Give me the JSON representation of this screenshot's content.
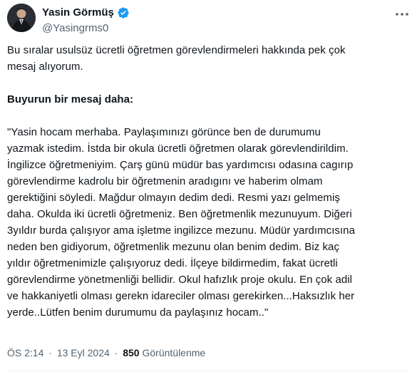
{
  "author": {
    "display_name": "Yasin Görmüş",
    "handle": "@Yasingrms0"
  },
  "icons": {
    "verified": "verified-badge-icon",
    "more": "more-options-icon",
    "verified_color": "#1d9bf0"
  },
  "body": {
    "intro_lines": [
      "Bu sıralar usulsüz ücretli öğretmen görevlendirmeleri hakkında pek çok",
      "mesaj alıyorum."
    ],
    "heading": "Buyurun bir mesaj daha:",
    "quote_lines": [
      "\"Yasin hocam merhaba. Paylaşımınızı görünce ben de durumumu",
      "yazmak istedim. İstda bir okula ücretli öğretmen olarak görevlendirildim.",
      "İngilizce öğretmeniyim. Çarş günü müdür bas yardımcısı odasına cagırıp",
      "görevlendirme kadrolu bir öğretmenin aradıgını ve haberim olmam",
      "gerektiğini söyledi. Mağdur olmayın dedim dedi. Resmi yazı gelmemiş",
      "daha. Okulda iki ücretli öğretmeniz. Ben öğretmenlik mezunuyum. Diğeri",
      "3yıldır burda çalışıyor ama işletme ingilizce mezunu. Müdür yardımcısına",
      "neden ben gidiyorum, öğretmenlik mezunu olan benim dedim. Biz kaç",
      "yıldır öğretmenimizle çalışıyoruz dedi. İlçeye bildirmedim, fakat ücretli",
      "görevlendirme yönetmenliği bellidir. Okul hafızlık proje okulu. En çok adil",
      "ve hakkaniyetli olması gerekn idareciler olması gerekirken...Haksızlık her",
      "yerde..Lütfen benim durumumu da paylaşınız hocam..\""
    ]
  },
  "meta": {
    "time": "ÖS 2:14",
    "separator": "·",
    "date": "13 Eyl 2024",
    "views_count": "850",
    "views_label": "Görüntülenme"
  }
}
